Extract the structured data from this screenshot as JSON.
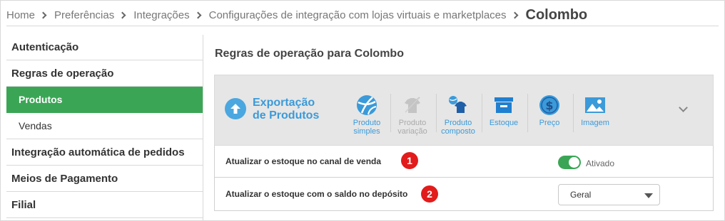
{
  "breadcrumb": {
    "items": [
      "Home",
      "Preferências",
      "Integrações",
      "Configurações de integração com lojas virtuais e marketplaces"
    ],
    "current": "Colombo"
  },
  "sidebar": {
    "items": [
      {
        "label": "Autenticação"
      },
      {
        "label": "Regras de operação"
      },
      {
        "label": "Produtos"
      },
      {
        "label": "Vendas"
      },
      {
        "label": "Integração automática de pedidos"
      },
      {
        "label": "Meios de Pagamento"
      },
      {
        "label": "Filial"
      }
    ]
  },
  "main": {
    "title": "Regras de operação para Colombo"
  },
  "toolbar": {
    "export_label_line1": "Exportação",
    "export_label_line2": "de Produtos",
    "buttons": [
      {
        "line1": "Produto",
        "line2": "simples",
        "icon": "ball-icon"
      },
      {
        "line1": "Produto",
        "line2": "variação",
        "icon": "shirt-variation-icon"
      },
      {
        "line1": "Produto",
        "line2": "composto",
        "icon": "composite-product-icon"
      },
      {
        "line1": "Estoque",
        "line2": "",
        "icon": "box-icon"
      },
      {
        "line1": "Preço",
        "line2": "",
        "icon": "dollar-icon"
      },
      {
        "line1": "Imagem",
        "line2": "",
        "icon": "image-icon"
      }
    ],
    "accent": "#3b9ad9"
  },
  "settings": {
    "row1": {
      "label": "Atualizar o estoque no canal de venda",
      "badge": "1",
      "toggle_label": "Ativado"
    },
    "row2": {
      "label": "Atualizar o estoque com o saldo no depósito",
      "badge": "2",
      "select_value": "Geral"
    }
  },
  "colors": {
    "active_green": "#3aa655",
    "badge_red": "#e21b1b"
  }
}
